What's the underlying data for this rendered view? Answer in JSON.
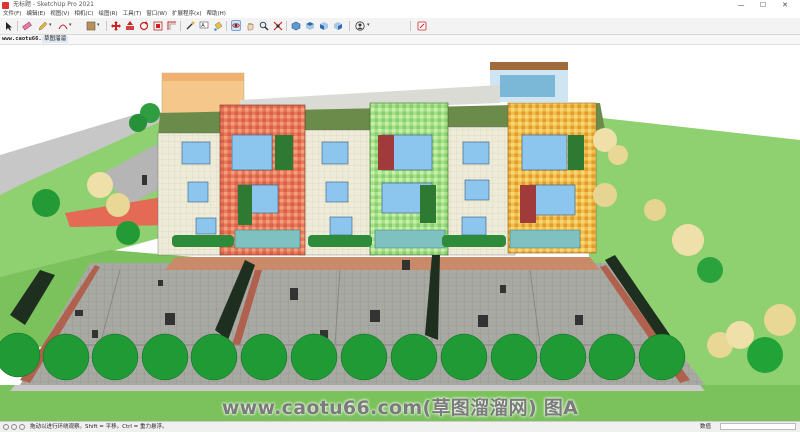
{
  "window": {
    "title": "无标题 - SketchUp Pro 2021",
    "controls": [
      "—",
      "☐",
      "✕"
    ]
  },
  "menu": [
    "文件(F)",
    "编辑(E)",
    "视图(V)",
    "相机(C)",
    "绘图(R)",
    "工具(T)",
    "窗口(W)",
    "扩展程序(x)",
    "帮助(H)"
  ],
  "toolbar": {
    "icons": [
      "select-icon",
      "eraser-icon",
      "pencil-icon",
      "arc-icon",
      "shape-icon",
      "paint-bucket-icon",
      "move-icon",
      "push-pull-icon",
      "rotate-icon",
      "scale-icon",
      "offset-icon",
      "tape-measure-icon",
      "text-icon",
      "paint-icon",
      "orbit-icon",
      "pan-icon",
      "zoom-icon",
      "zoom-extents-icon",
      "iso-view-icon",
      "top-view-icon",
      "front-view-icon",
      "right-view-icon",
      "back-view-icon",
      "user-icon",
      "warehouse-icon"
    ]
  },
  "scenebar": {
    "url": "www.caotu66.com",
    "tab": "草图溜溜"
  },
  "viewport": {
    "watermark": "www.caotu66.com(草图溜溜网) 图A",
    "sky": "#ffffff",
    "lawn": "#8fd071",
    "pavement": "#9c9c9c"
  },
  "status": {
    "text": "拖动以进行环绕观察。Shift = 平移。Ctrl = 重力悬浮。",
    "measure_label": "数值",
    "measure_value": ""
  }
}
